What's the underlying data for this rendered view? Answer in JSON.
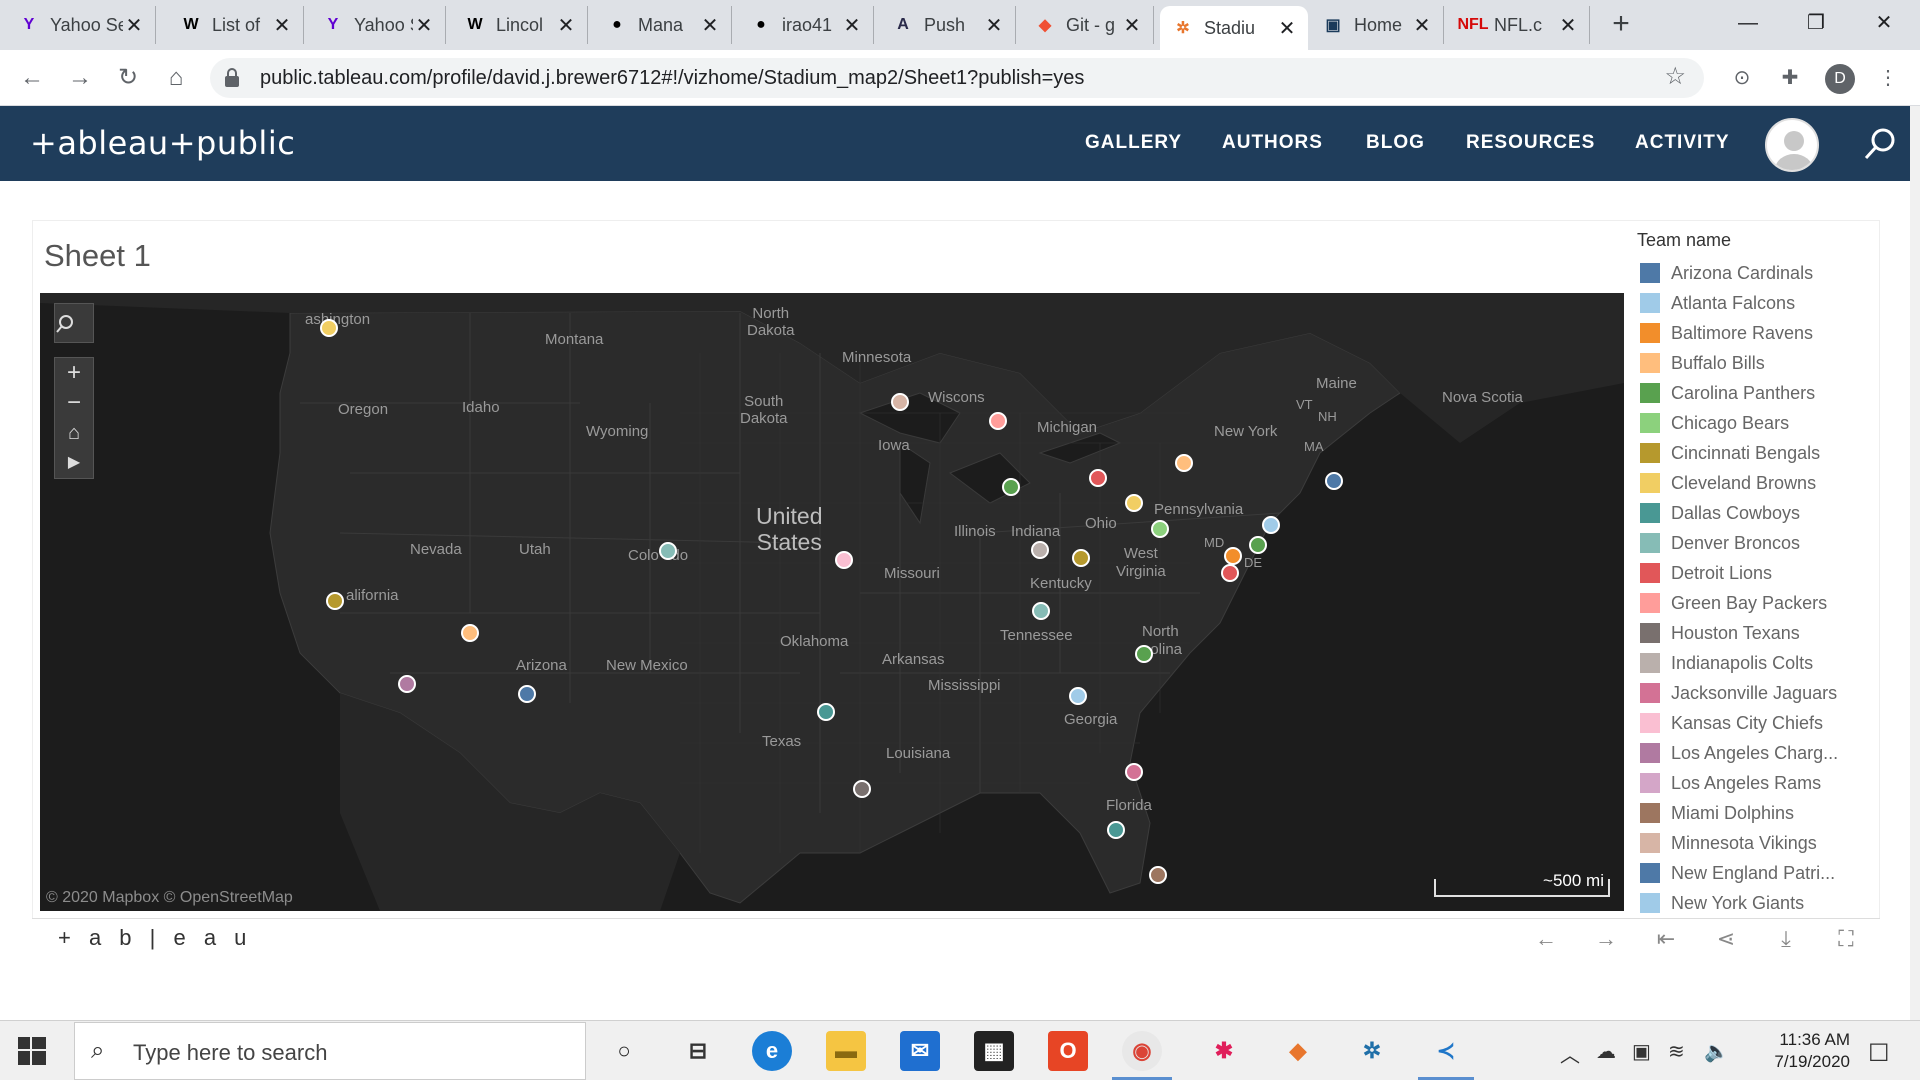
{
  "browser": {
    "tabs": [
      {
        "title": "Yahoo Sea",
        "favicon": "yahoo-icon",
        "color": "#6001d2",
        "glyph": "Y"
      },
      {
        "title": "List of",
        "favicon": "wikipedia-icon",
        "color": "#000000",
        "glyph": "W"
      },
      {
        "title": "Yahoo Sea",
        "favicon": "yahoo-icon",
        "color": "#6001d2",
        "glyph": "Y"
      },
      {
        "title": "Lincol",
        "favicon": "wikipedia-icon",
        "color": "#000000",
        "glyph": "W"
      },
      {
        "title": "Mana",
        "favicon": "github-icon",
        "color": "#000000",
        "glyph": "●"
      },
      {
        "title": "irao41",
        "favicon": "github-icon",
        "color": "#000000",
        "glyph": "●"
      },
      {
        "title": "Push",
        "favicon": "heroku-icon",
        "color": "#2a2a4a",
        "glyph": "A"
      },
      {
        "title": "Git - g",
        "favicon": "git-icon",
        "color": "#f05033",
        "glyph": "◆"
      },
      {
        "title": "Stadiu",
        "favicon": "tableau-icon",
        "color": "#e8762d",
        "glyph": "✲",
        "active": true
      },
      {
        "title": "Home",
        "favicon": "app-icon",
        "color": "#1a3a5a",
        "glyph": "▣"
      },
      {
        "title": "NFL.c",
        "favicon": "nfl-icon",
        "color": "#d50a0a",
        "glyph": "NFL"
      }
    ],
    "url": "public.tableau.com/profile/david.j.brewer6712#!/vizhome/Stadium_map2/Sheet1?publish=yes",
    "profile_initial": "D"
  },
  "header": {
    "logo": "+ableau+public",
    "nav": [
      "GALLERY",
      "AUTHORS",
      "BLOG",
      "RESOURCES",
      "ACTIVITY"
    ]
  },
  "viz": {
    "sheet_title": "Sheet 1",
    "attribution": "© 2020 Mapbox  © OpenStreetMap",
    "scale_label": "~500 mi",
    "footer_brand": "+ a b | e a u"
  },
  "map_labels": {
    "washington": "ashington",
    "montana": "Montana",
    "north_dakota": "North\nDakota",
    "minnesota": "Minnesota",
    "south_dakota": "South\nDakota",
    "wisconsin": "Wiscons",
    "oregon": "Oregon",
    "idaho": "Idaho",
    "wyoming": "Wyoming",
    "iowa": "Iowa",
    "michigan": "Michigan",
    "new_york": "New York",
    "maine": "Maine",
    "nova_scotia": "Nova Scotia",
    "vt": "VT",
    "nh": "NH",
    "ma": "MA",
    "pennsylvania": "Pennsylvania",
    "united_states": "United\nStates",
    "nevada": "Nevada",
    "utah": "Utah",
    "colorado": "Colo   do",
    "illinois": "Illinois",
    "indiana": "Indiana",
    "ohio": "Ohio",
    "md": "MD",
    "de": "DE",
    "west_virginia": "West\nVirginia",
    "missouri": "Missouri",
    "kentucky": "Kentucky",
    "california": "alifornia",
    "tennessee": "Tennessee",
    "north_carolina": "North\n  olina",
    "oklahoma": "Oklahoma",
    "arkansas": "Arkansas",
    "arizona": "Arizona",
    "new_mexico": "New Mexico",
    "mississippi": "Mississippi",
    "georgia": "Georgia",
    "texas": "Texas",
    "louisiana": "Louisiana",
    "florida": "Florida"
  },
  "legend": {
    "title": "Team name",
    "items": [
      {
        "name": "Arizona Cardinals",
        "color": "#4e79a7"
      },
      {
        "name": "Atlanta Falcons",
        "color": "#a0cbe8"
      },
      {
        "name": "Baltimore Ravens",
        "color": "#f28e2b"
      },
      {
        "name": "Buffalo Bills",
        "color": "#ffbe7d"
      },
      {
        "name": "Carolina Panthers",
        "color": "#59a14f"
      },
      {
        "name": "Chicago Bears",
        "color": "#8cd17d"
      },
      {
        "name": "Cincinnati Bengals",
        "color": "#b6992d"
      },
      {
        "name": "Cleveland Browns",
        "color": "#f1ce63"
      },
      {
        "name": "Dallas Cowboys",
        "color": "#499894"
      },
      {
        "name": "Denver Broncos",
        "color": "#86bcb6"
      },
      {
        "name": "Detroit Lions",
        "color": "#e15759"
      },
      {
        "name": "Green Bay Packers",
        "color": "#ff9d9a"
      },
      {
        "name": "Houston Texans",
        "color": "#79706e"
      },
      {
        "name": "Indianapolis Colts",
        "color": "#bab0ac"
      },
      {
        "name": "Jacksonville Jaguars",
        "color": "#d37295"
      },
      {
        "name": "Kansas City Chiefs",
        "color": "#fabfd2"
      },
      {
        "name": "Los Angeles Charg...",
        "color": "#b07aa1"
      },
      {
        "name": "Los Angeles Rams",
        "color": "#d4a6c8"
      },
      {
        "name": "Miami Dolphins",
        "color": "#9d7660"
      },
      {
        "name": "Minnesota Vikings",
        "color": "#d7b5a6"
      },
      {
        "name": "New England Patri...",
        "color": "#4e79a7"
      },
      {
        "name": "New York Giants",
        "color": "#a0cbe8"
      }
    ]
  },
  "stadiums": [
    {
      "team": "Seattle",
      "color": "#f1ce63"
    },
    {
      "team": "San Francisco",
      "color": "#b6992d"
    },
    {
      "team": "Las Vegas",
      "color": "#ffbe7d"
    },
    {
      "team": "Los Angeles",
      "color": "#b07aa1"
    },
    {
      "team": "Arizona Cardinals",
      "color": "#4e79a7"
    },
    {
      "team": "Denver Broncos",
      "color": "#86bcb6"
    },
    {
      "team": "Kansas City Chiefs",
      "color": "#fabfd2"
    },
    {
      "team": "Minnesota Vikings",
      "color": "#d7b5a6"
    },
    {
      "team": "Green Bay Packers",
      "color": "#ff9d9a"
    },
    {
      "team": "Chicago Bears",
      "color": "#59a14f"
    },
    {
      "team": "Detroit Lions",
      "color": "#e15759"
    },
    {
      "team": "Buffalo Bills",
      "color": "#ffbe7d"
    },
    {
      "team": "Cleveland Browns",
      "color": "#f1ce63"
    },
    {
      "team": "Pittsburgh",
      "color": "#8cd17d"
    },
    {
      "team": "Indianapolis Colts",
      "color": "#bab0ac"
    },
    {
      "team": "Cincinnati Bengals",
      "color": "#b6992d"
    },
    {
      "team": "New England Patriots",
      "color": "#4e79a7"
    },
    {
      "team": "New York Giants",
      "color": "#a0cbe8"
    },
    {
      "team": "Philadelphia",
      "color": "#59a14f"
    },
    {
      "team": "Baltimore Ravens",
      "color": "#f28e2b"
    },
    {
      "team": "Washington",
      "color": "#e15759"
    },
    {
      "team": "Tennessee",
      "color": "#86bcb6"
    },
    {
      "team": "Carolina Panthers",
      "color": "#59a14f"
    },
    {
      "team": "Atlanta Falcons",
      "color": "#a0cbe8"
    },
    {
      "team": "Dallas Cowboys",
      "color": "#499894"
    },
    {
      "team": "Houston Texans",
      "color": "#79706e"
    },
    {
      "team": "Jacksonville Jaguars",
      "color": "#d37295"
    },
    {
      "team": "Tampa Bay",
      "color": "#499894"
    },
    {
      "team": "Miami Dolphins",
      "color": "#9d7660"
    }
  ],
  "taskbar": {
    "search_placeholder": "Type here to search",
    "time": "11:36 AM",
    "date": "7/19/2020"
  }
}
